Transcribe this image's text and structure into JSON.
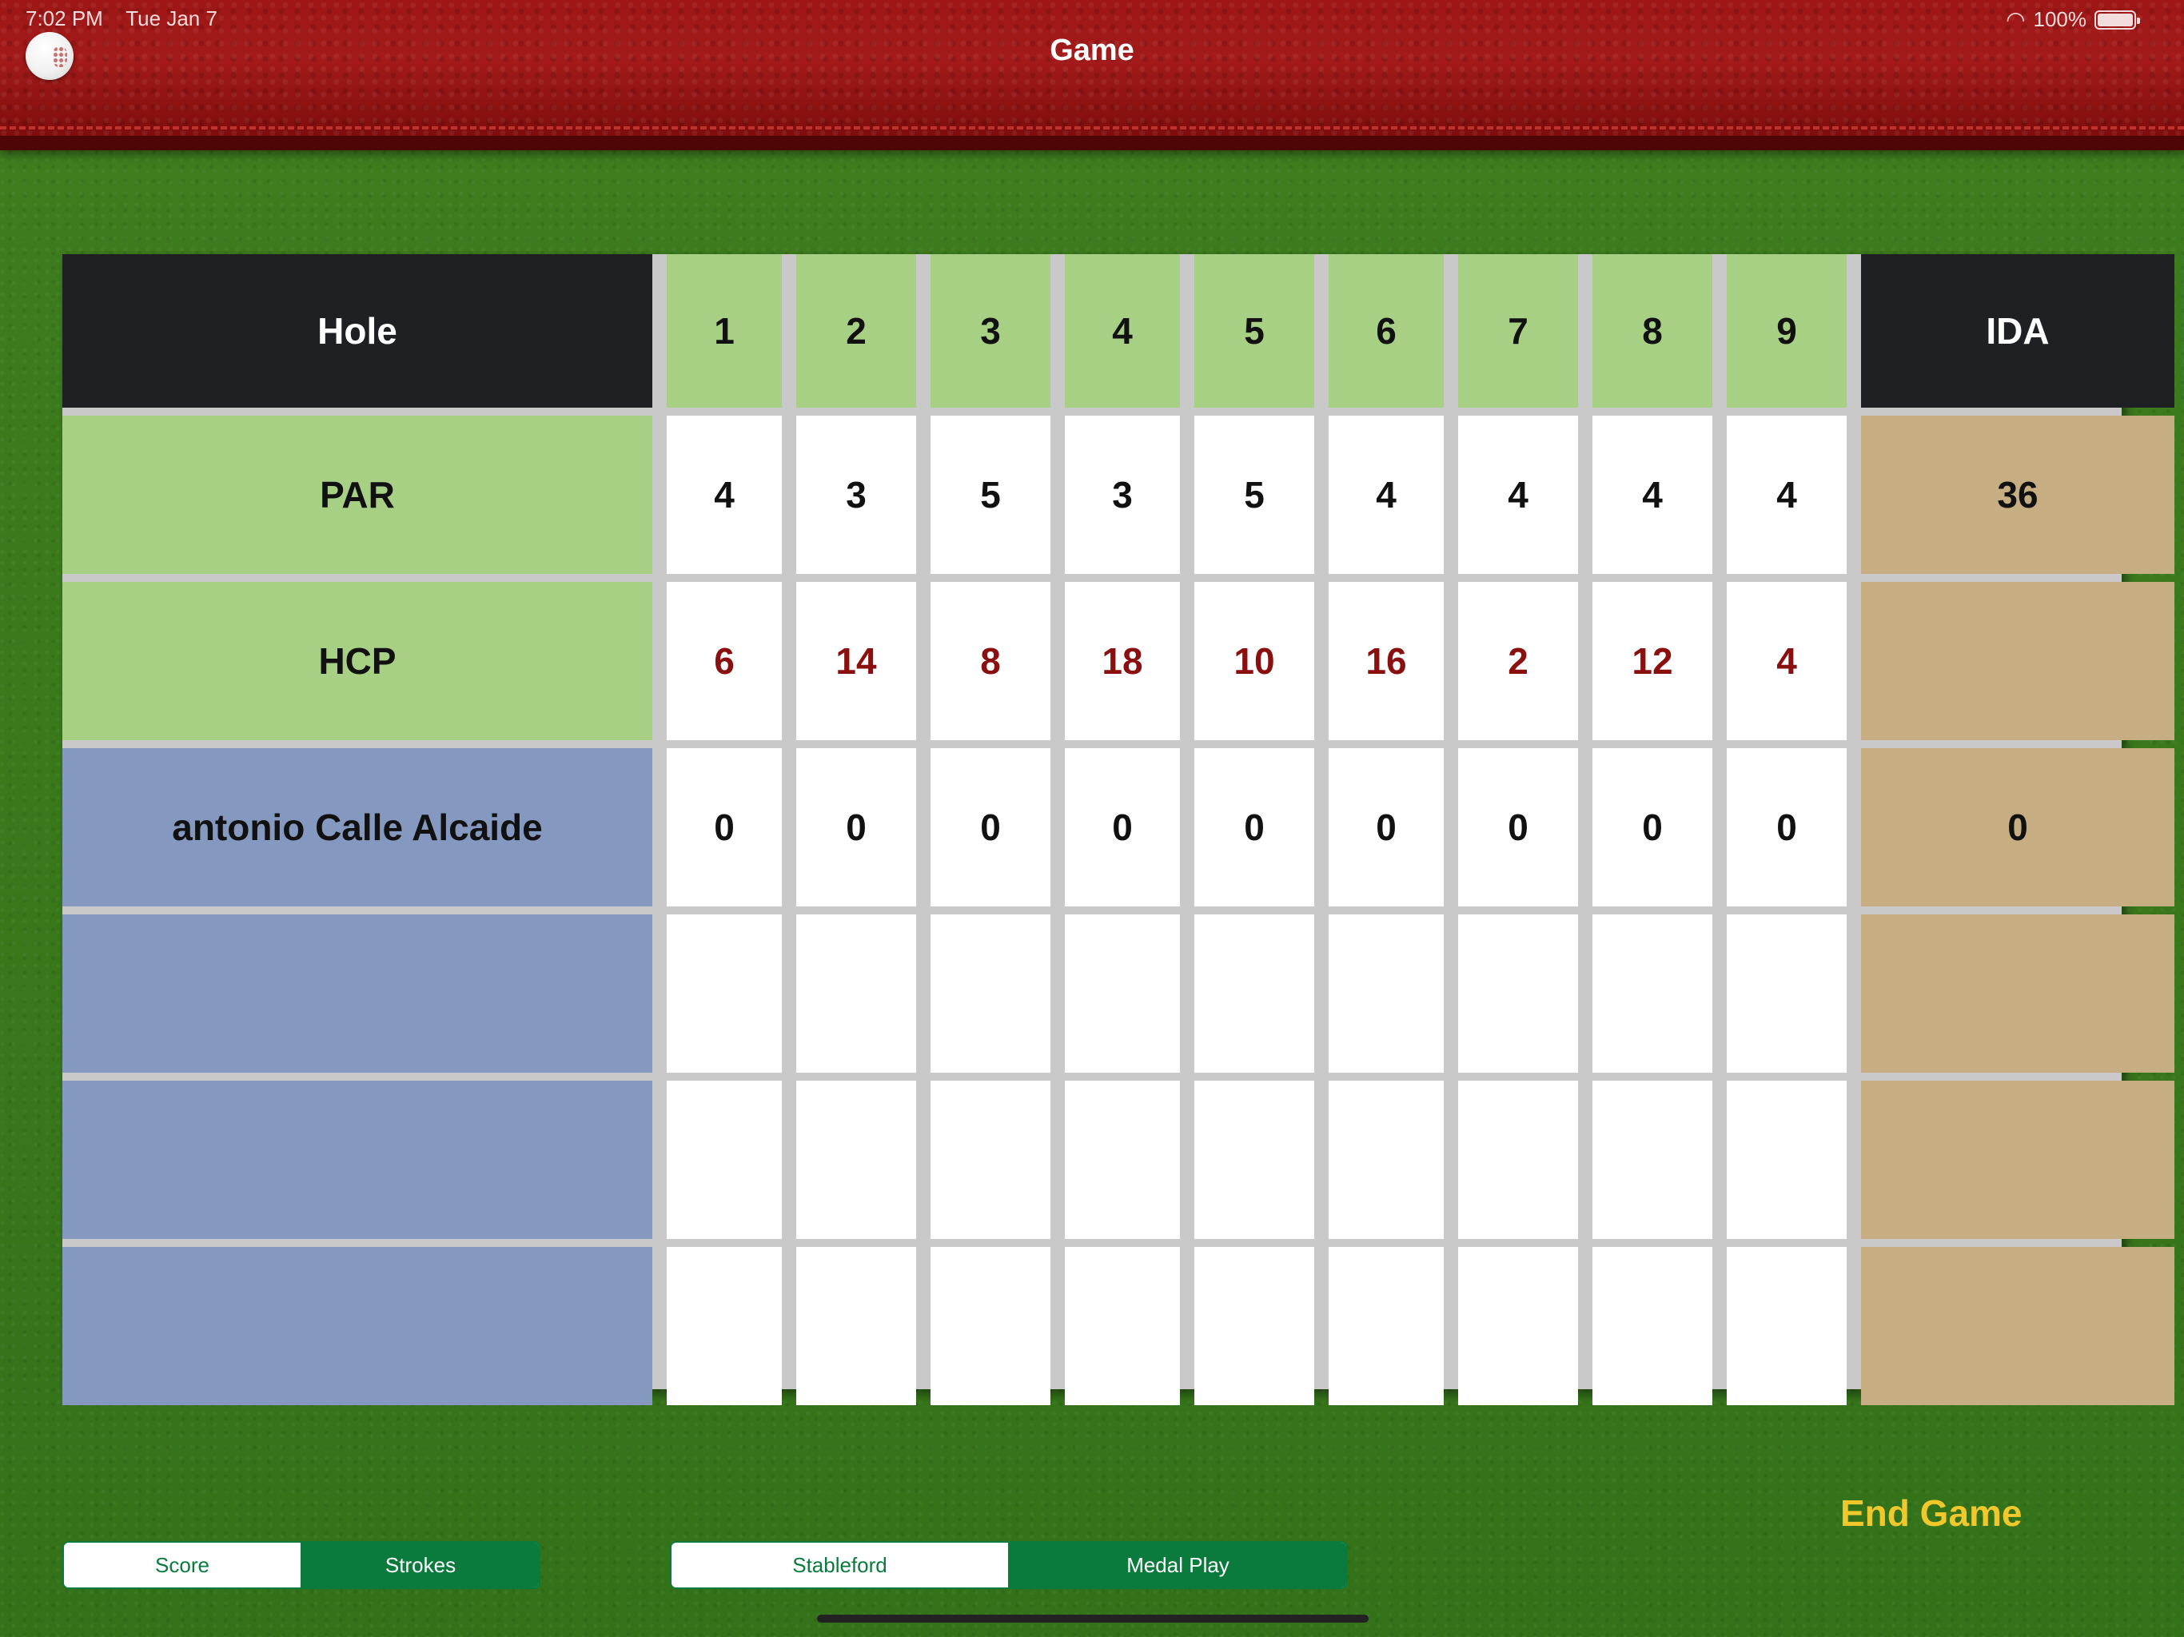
{
  "status_bar": {
    "time": "7:02 PM",
    "date": "Tue Jan 7",
    "battery": "100%"
  },
  "header": {
    "title": "Game"
  },
  "scorecard": {
    "hole_label": "Hole",
    "holes": [
      "1",
      "2",
      "3",
      "4",
      "5",
      "6",
      "7",
      "8",
      "9"
    ],
    "total_label": "IDA",
    "par_label": "PAR",
    "par": [
      "4",
      "3",
      "5",
      "3",
      "5",
      "4",
      "4",
      "4",
      "4"
    ],
    "par_total": "36",
    "hcp_label": "HCP",
    "hcp": [
      "6",
      "14",
      "8",
      "18",
      "10",
      "16",
      "2",
      "12",
      "4"
    ],
    "hcp_total": "",
    "players": [
      {
        "name": "antonio Calle Alcaide",
        "scores": [
          "0",
          "0",
          "0",
          "0",
          "0",
          "0",
          "0",
          "0",
          "0"
        ],
        "total": "0"
      },
      {
        "name": "",
        "scores": [
          "",
          "",
          "",
          "",
          "",
          "",
          "",
          "",
          ""
        ],
        "total": ""
      },
      {
        "name": "",
        "scores": [
          "",
          "",
          "",
          "",
          "",
          "",
          "",
          "",
          ""
        ],
        "total": ""
      },
      {
        "name": "",
        "scores": [
          "",
          "",
          "",
          "",
          "",
          "",
          "",
          "",
          ""
        ],
        "total": ""
      }
    ]
  },
  "controls": {
    "mode_toggle": {
      "options": [
        "Score",
        "Strokes"
      ],
      "selected": "Strokes"
    },
    "format_toggle": {
      "options": [
        "Stableford",
        "Medal Play"
      ],
      "selected": "Medal Play"
    },
    "end_game_label": "End Game"
  },
  "colors": {
    "header_red": "#a31a1a",
    "dark_header": "#1f2024",
    "light_green": "#a8d085",
    "player_blue": "#8599c0",
    "total_tan": "#c6ad82",
    "hcp_red": "#8a0f0f",
    "accent_green": "#0b7a3d",
    "end_game_yellow": "#f1c82c"
  }
}
